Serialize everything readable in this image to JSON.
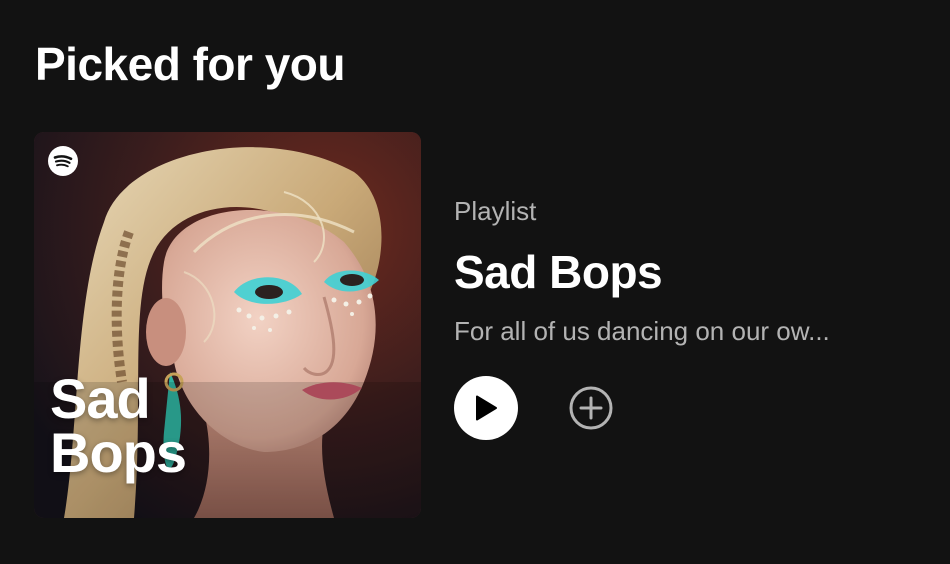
{
  "section": {
    "title": "Picked for you"
  },
  "playlist": {
    "type_label": "Playlist",
    "title": "Sad Bops",
    "description": "For all of us dancing on our ow...",
    "cover": {
      "title_line1": "Sad",
      "title_line2": "Bops",
      "logo_icon": "spotify-logo-icon",
      "image": "portrait-with-teal-eye-makeup"
    }
  },
  "actions": {
    "play_icon": "play-icon",
    "add_icon": "add-circle-icon"
  },
  "colors": {
    "background": "#121212",
    "text_primary": "#ffffff",
    "text_secondary": "#b3b3b3",
    "play_button_bg": "#ffffff",
    "add_icon_color": "#b3b3b3",
    "cover_accent": "#3fd0d4"
  }
}
